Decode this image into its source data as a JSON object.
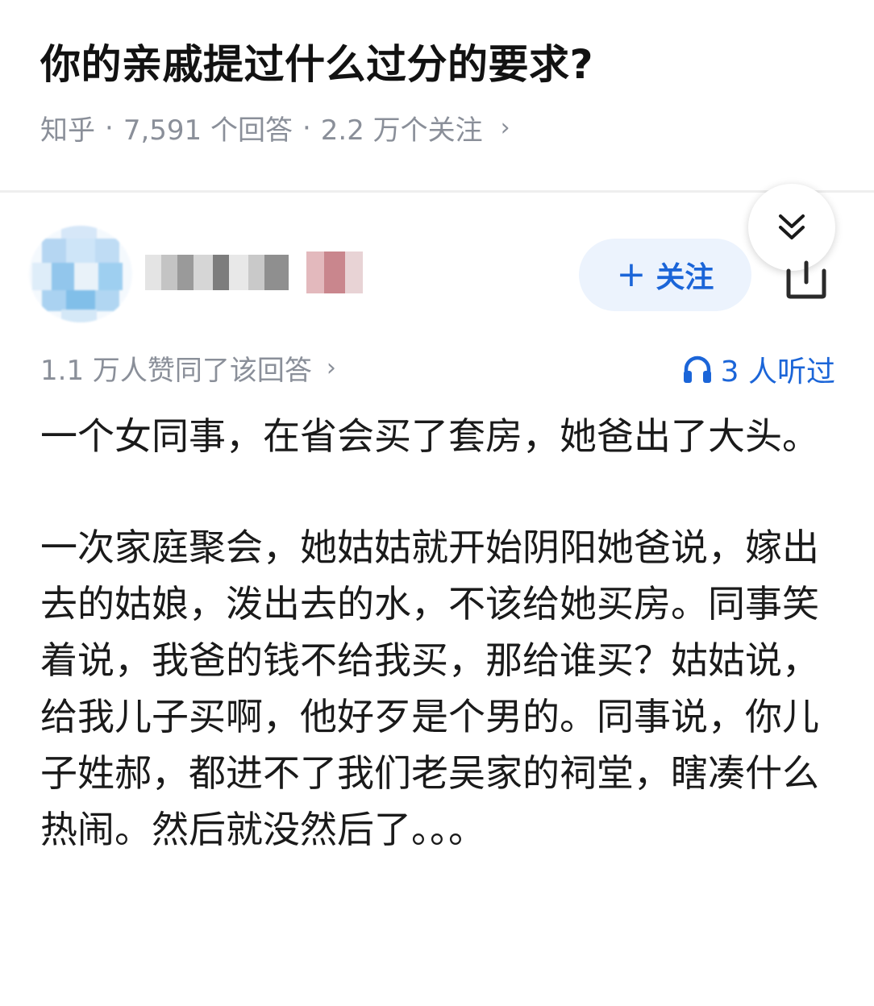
{
  "question": {
    "title": "你的亲戚提过什么过分的要求?",
    "source": "知乎",
    "separator": "·",
    "answer_count": "7,591 个回答",
    "follower_count": "2.2 万个关注",
    "chevron": "›"
  },
  "answer": {
    "follow_label": "关注",
    "follow_plus": "+",
    "likes_text": "1.1 万人赞同了该回答",
    "likes_chevron": "›",
    "listened_text": "3 人听过",
    "paragraphs": [
      "一个女同事，在省会买了套房，她爸出了大头。",
      "一次家庭聚会，她姑姑就开始阴阳她爸说，嫁出去的姑娘，泼出去的水，不该给她买房。同事笑着说，我爸的钱不给我买，那给谁买？姑姑说，给我儿子买啊，他好歹是个男的。同事说，你儿子姓郝，都进不了我们老吴家的祠堂，瞎凑什么热闹。然后就没然后了。。。"
    ]
  },
  "colors": {
    "accent_blue": "#1b65d8",
    "follow_bg": "#ecf3fd",
    "meta_gray": "#8a8f99",
    "title": "#121212"
  },
  "icons": {
    "collapse": "double-chevron-down-icon",
    "share": "share-icon",
    "headphones": "headphones-icon",
    "avatar": "blurred-avatar",
    "author_name": "blurred-author-name"
  }
}
